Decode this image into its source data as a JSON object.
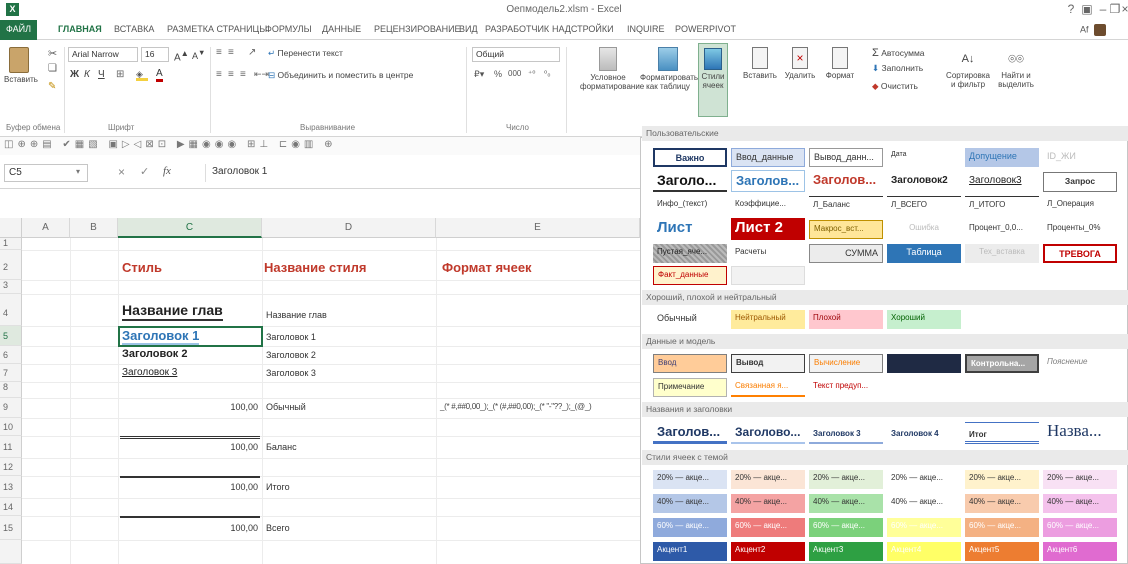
{
  "app": {
    "title": "Оепмодель2.xlsm - Excel",
    "help": "?",
    "user": "Af"
  },
  "tabs": [
    "ФАЙЛ",
    "ГЛАВНАЯ",
    "ВСТАВКА",
    "РАЗМЕТКА СТРАНИЦЫ",
    "ФОРМУЛЫ",
    "ДАННЫЕ",
    "РЕЦЕНЗИРОВАНИЕ",
    "ВИД",
    "РАЗРАБОТЧИК",
    "НАДСТРОЙКИ",
    "INQUIRE",
    "POWERPIVOT"
  ],
  "ribbon": {
    "paste": "Вставить",
    "font_name": "Arial Narrow",
    "font_size": "16",
    "wrap_text": "Перенести текст",
    "merge_center": "Объединить и поместить в центре",
    "number_format": "Общий",
    "conditional": [
      "Условное",
      "форматирование"
    ],
    "format_table": [
      "Форматировать",
      "как таблицу"
    ],
    "cell_styles": [
      "Стили",
      "ячеек"
    ],
    "insert": "Вставить",
    "delete": "Удалить",
    "format": "Формат",
    "autosum": "Автосумма",
    "fill": "Заполнить",
    "clear": "Очистить",
    "sort_filter": [
      "Сортировка",
      "и фильтр"
    ],
    "find_select": [
      "Найти и",
      "выделить"
    ],
    "groups": {
      "clipboard": "Буфер обмена",
      "font": "Шрифт",
      "alignment": "Выравнивание",
      "number": "Число"
    }
  },
  "formula_bar": {
    "name_box": "C5",
    "formula": "Заголовок 1"
  },
  "grid": {
    "columns": [
      "A",
      "B",
      "C",
      "D",
      "E"
    ],
    "rows": [
      "1",
      "2",
      "3",
      "4",
      "5",
      "6",
      "7",
      "8",
      "9",
      "10",
      "11",
      "12",
      "13",
      "14",
      "15"
    ],
    "headers": {
      "style": "Стиль",
      "style_name": "Название стиля",
      "cell_format": "Формат ячеек"
    },
    "examples": [
      {
        "sample": "Название глав",
        "name": "Название глав"
      },
      {
        "sample": "Заголовок 1",
        "name": "Заголовок 1"
      },
      {
        "sample": "Заголовок 2",
        "name": "Заголовок 2"
      },
      {
        "sample": "Заголовок 3",
        "name": "Заголовок 3"
      },
      {
        "sample": "100,00",
        "name": "Обычный",
        "format": "_(* #,##0,00_);_(* (#,##0,00);_(* \"-\"??_);_(@_)"
      },
      {
        "sample": "100,00",
        "name": "Баланс"
      },
      {
        "sample": "100,00",
        "name": "Итого"
      },
      {
        "sample": "100,00",
        "name": "Всего"
      }
    ]
  },
  "gallery": {
    "sections": {
      "custom": "Пользовательские",
      "good_bad": "Хороший, плохой и нейтральный",
      "data_model": "Данные и модель",
      "titles": "Названия и заголовки",
      "themed": "Стили ячеек с темой"
    },
    "custom_rows": [
      [
        "Важно",
        "Ввод_данные",
        "Вывод_данн...",
        "Дата",
        "Допущение",
        "ID_ЖИ"
      ],
      [
        "Заголо...",
        "Заголов...",
        "Заголов...",
        "Заголовок2",
        "Заголовок3",
        "Запрос"
      ],
      [
        "Инфо_(текст)",
        "Коэффицие...",
        "Л_Баланс",
        "Л_ВСЕГО",
        "Л_ИТОГО",
        "Л_Операция"
      ],
      [
        "Лист",
        "Лист 2",
        "Макрос_вст...",
        "Ошибка",
        "Процент_0,0...",
        "Проценты_0%"
      ],
      [
        "Пустая_яче...",
        "Расчеты",
        "СУММА",
        "Таблица",
        "Тех_вставка",
        "ТРЕВОГА"
      ],
      [
        "Факт_данные",
        ""
      ]
    ],
    "good_bad_row": [
      "Обычный",
      "Нейтральный",
      "Плохой",
      "Хороший"
    ],
    "data_rows": [
      [
        "Ввод",
        "Вывод",
        "Вычисление",
        "",
        "Контрольна...",
        "Пояснение"
      ],
      [
        "Примечание",
        "Связанная я...",
        "Текст предуп..."
      ]
    ],
    "titles_row": [
      "Заголов...",
      "Заголово...",
      "Заголовок 3",
      "Заголовок 4",
      "Итог",
      "Назва..."
    ],
    "themed_rows": [
      [
        "20% — акце...",
        "20% — акце...",
        "20% — акце...",
        "20% — акце...",
        "20% — акце...",
        "20% — акце..."
      ],
      [
        "40% — акце...",
        "40% — акце...",
        "40% — акце...",
        "40% — акце...",
        "40% — акце...",
        "40% — акце..."
      ],
      [
        "60% — акце...",
        "60% — акце...",
        "60% — акце...",
        "60% — акце...",
        "60% — акце...",
        "60% — акце..."
      ],
      [
        "Акцент1",
        "Акцент2",
        "Акцент3",
        "Акцент4",
        "Акцент5",
        "Акцент6"
      ]
    ]
  },
  "colors": {
    "excel_green": "#217346",
    "header_red": "#c0392b",
    "heading_blue": "#2e75b6"
  }
}
